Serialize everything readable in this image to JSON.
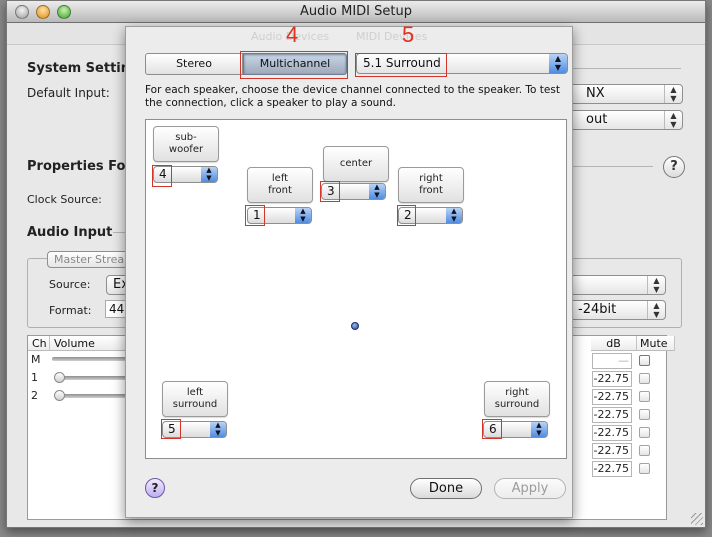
{
  "window": {
    "title": "Audio MIDI Setup"
  },
  "background": {
    "system_settings_heading": "System Setting",
    "default_input_label": "Default Input:",
    "default_input_value_partial": "NX",
    "default_output_value_partial": "out",
    "properties_for_heading": "Properties For:",
    "clock_source_label": "Clock Source:",
    "audio_input_heading": "Audio Input",
    "master_stream_button": "Master Stream",
    "source_label": "Source:",
    "source_value_partial": "Ex",
    "format_label": "Format:",
    "format_value_partial": "44",
    "format_right_partial": "-24bit",
    "help_label": "?",
    "table": {
      "columns": [
        "Ch",
        "Volume",
        "dB",
        "Mute"
      ],
      "rows": [
        {
          "ch": "M",
          "db": "—"
        },
        {
          "ch": "1",
          "db": "-22.75"
        },
        {
          "ch": "2",
          "db": "-22.75"
        },
        {
          "ch": "",
          "db": "-22.75"
        },
        {
          "ch": "",
          "db": "-22.75"
        },
        {
          "ch": "",
          "db": "-22.75"
        },
        {
          "ch": "",
          "db": "-22.75"
        }
      ]
    }
  },
  "sheet": {
    "ghost_tabs": [
      "Audio Devices",
      "MIDI Devices"
    ],
    "segments": {
      "stereo": "Stereo",
      "multichannel": "Multichannel",
      "selected": "Multichannel"
    },
    "layout_popup": {
      "value": "5.1 Surround"
    },
    "instructions": "For each speaker, choose the device channel connected to the speaker. To test the connection, click a speaker to play a sound.",
    "speakers": [
      {
        "id": "subwoofer",
        "label_line1": "sub-",
        "label_line2": "woofer",
        "channel": "4"
      },
      {
        "id": "left-front",
        "label_line1": "left",
        "label_line2": "front",
        "channel": "1"
      },
      {
        "id": "center",
        "label_line1": "center",
        "label_line2": "",
        "channel": "3"
      },
      {
        "id": "right-front",
        "label_line1": "right",
        "label_line2": "front",
        "channel": "2"
      },
      {
        "id": "left-surround",
        "label_line1": "left",
        "label_line2": "surround",
        "channel": "5"
      },
      {
        "id": "right-surround",
        "label_line1": "right",
        "label_line2": "surround",
        "channel": "6"
      }
    ],
    "help_label": "?",
    "done_button": "Done",
    "apply_button": "Apply"
  },
  "annotations": {
    "step_4": "4",
    "step_5": "5",
    "color": "#e0301e"
  },
  "icons": {
    "popup_arrows": "▲▼",
    "close": "close-icon",
    "minimize": "minimize-icon",
    "zoom": "zoom-icon"
  }
}
